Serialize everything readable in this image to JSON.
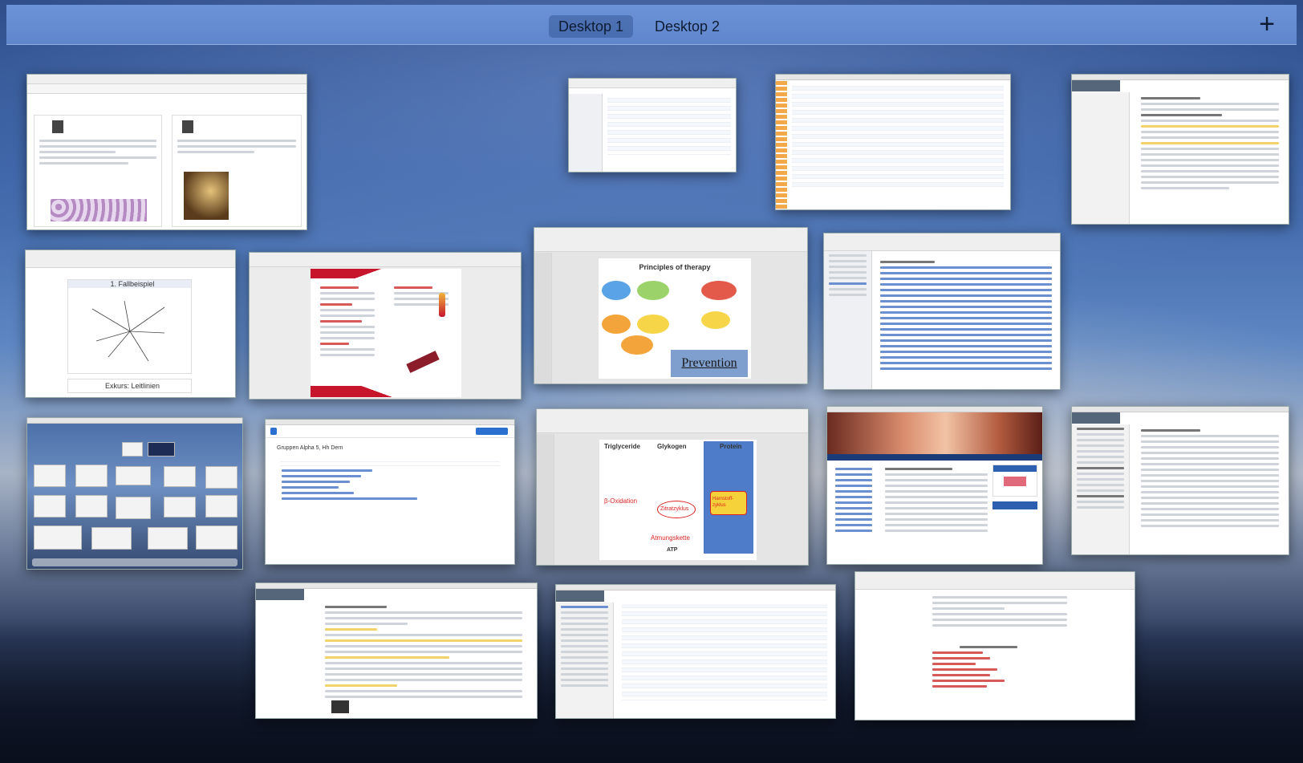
{
  "spaces": {
    "tabs": [
      {
        "label": "Desktop 1",
        "active": true
      },
      {
        "label": "Desktop 2",
        "active": false
      }
    ],
    "add_label": "+"
  },
  "windows": {
    "slide_principles_title": "Principles of therapy",
    "slide_prevention_label": "Prevention",
    "slide_fallbeispiel_title": "1. Fallbeispiel",
    "slide_exkurs_title": "Exkurs: Leitlinien",
    "slide_metabolism": {
      "triglyceride": "Triglyceride",
      "glykogen": "Glykogen",
      "protein": "Protein",
      "oxidation": "β-Oxidation",
      "zitrat": "Zitratzyklus",
      "atmung": "Atmungskette",
      "atp": "ATP",
      "harnstoff": "Harnstoff-zyklus"
    },
    "finder_group_label": "Gruppen Alpha 5, Hh Dern"
  },
  "colors": {
    "spaces_bar": "#6c93d8",
    "active_tab_bg": "#3c5f9e",
    "slide_blue": "#7f9fce",
    "metab_panel": "#4f7cc9"
  }
}
